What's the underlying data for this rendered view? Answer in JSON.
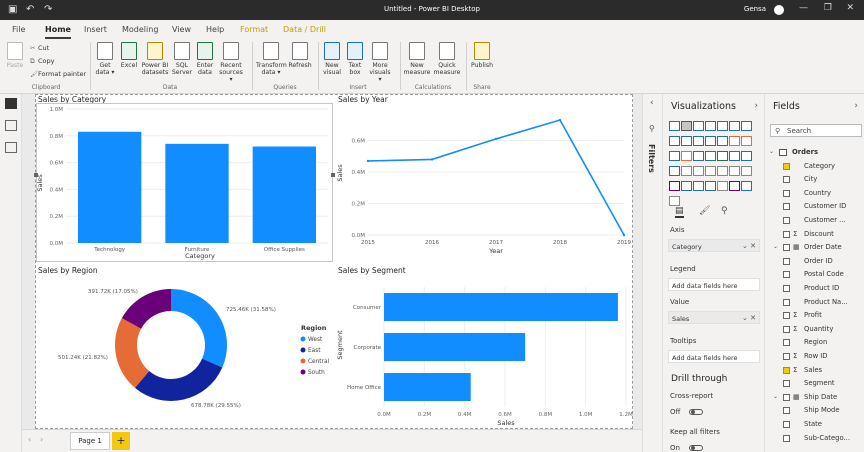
{
  "window": {
    "title": "Untitled - Power BI Desktop",
    "user": "Gensa"
  },
  "menu": {
    "file": "File",
    "home": "Home",
    "insert": "Insert",
    "modeling": "Modeling",
    "view": "View",
    "help": "Help",
    "format": "Format",
    "data_drill": "Data / Drill"
  },
  "ribbon": {
    "paste": "Paste",
    "cut": "Cut",
    "copy": "Copy",
    "format_painter": "Format painter",
    "clipboard_group": "Clipboard",
    "get_data": "Get data",
    "excel": "Excel",
    "pbi_datasets": "Power BI datasets",
    "sql_server": "SQL Server",
    "enter_data": "Enter data",
    "recent_sources": "Recent sources",
    "data_group": "Data",
    "transform_data": "Transform data",
    "refresh": "Refresh",
    "queries_group": "Queries",
    "new_visual": "New visual",
    "text_box": "Text box",
    "more_visuals": "More visuals",
    "insert_group": "Insert",
    "new_measure": "New measure",
    "quick_measure": "Quick measure",
    "calculations_group": "Calculations",
    "publish": "Publish",
    "share_group": "Share"
  },
  "report": {
    "category": {
      "title": "Sales by Category",
      "ylabel": "Sales",
      "xlabel": "Category"
    },
    "year": {
      "title": "Sales by Year",
      "ylabel": "Sales",
      "xlabel": "Year"
    },
    "region": {
      "title": "Sales by Region",
      "legend_title": "Region"
    },
    "segment": {
      "title": "Sales by Segment",
      "ylabel": "Segment",
      "xlabel": "Sales"
    }
  },
  "chart_data": [
    {
      "type": "bar",
      "title": "Sales by Category",
      "xlabel": "Category",
      "ylabel": "Sales",
      "categories": [
        "Technology",
        "Furniture",
        "Office Supplies"
      ],
      "values": [
        0.83,
        0.74,
        0.72
      ],
      "unit": "M",
      "ylim": [
        0,
        1.0
      ],
      "yticks": [
        "0.0M",
        "0.2M",
        "0.4M",
        "0.6M",
        "0.8M",
        "1.0M"
      ]
    },
    {
      "type": "line",
      "title": "Sales by Year",
      "xlabel": "Year",
      "ylabel": "Sales",
      "x": [
        2015,
        2016,
        2017,
        2018,
        2019
      ],
      "values": [
        0.47,
        0.48,
        0.61,
        0.73,
        0.0
      ],
      "unit": "M",
      "ylim": [
        0,
        0.8
      ],
      "yticks": [
        "0.0M",
        "0.2M",
        "0.4M",
        "0.6M"
      ]
    },
    {
      "type": "pie",
      "subtype": "donut",
      "title": "Sales by Region",
      "legend_title": "Region",
      "slices": [
        {
          "name": "West",
          "value": 725.46,
          "label": "725.46K (31.58%)",
          "color": "#118DFF"
        },
        {
          "name": "East",
          "value": 678.78,
          "label": "678.78K (29.55%)",
          "color": "#12239E"
        },
        {
          "name": "Central",
          "value": 501.24,
          "label": "501.24K (21.82%)",
          "color": "#E66C37"
        },
        {
          "name": "South",
          "value": 391.72,
          "label": "391.72K (17.05%)",
          "color": "#6B007B"
        }
      ]
    },
    {
      "type": "bar",
      "orientation": "horizontal",
      "title": "Sales by Segment",
      "xlabel": "Sales",
      "ylabel": "Segment",
      "categories": [
        "Consumer",
        "Corporate",
        "Home Office"
      ],
      "values": [
        1.16,
        0.7,
        0.43
      ],
      "unit": "M",
      "xlim": [
        0,
        1.2
      ],
      "xticks": [
        "0.0M",
        "0.2M",
        "0.4M",
        "0.6M",
        "0.8M",
        "1.0M",
        "1.2M"
      ]
    }
  ],
  "pages": {
    "page1": "Page 1",
    "add": "+"
  },
  "filters": {
    "label": "Filters"
  },
  "visualizations": {
    "title": "Visualizations",
    "axis": "Axis",
    "axis_value": "Category",
    "legend": "Legend",
    "add_fields": "Add data fields here",
    "value": "Value",
    "value_field": "Sales",
    "tooltips": "Tooltips",
    "drill_through": "Drill through",
    "cross_report": "Cross-report",
    "off": "Off",
    "keep_all_filters": "Keep all filters",
    "on": "On"
  },
  "fields": {
    "title": "Fields",
    "search_placeholder": "Search",
    "items": [
      {
        "name": "Orders",
        "kind": "table"
      },
      {
        "name": "Category",
        "kind": "field",
        "checked": true
      },
      {
        "name": "City",
        "kind": "field"
      },
      {
        "name": "Country",
        "kind": "field"
      },
      {
        "name": "Customer ID",
        "kind": "field"
      },
      {
        "name": "Customer ...",
        "kind": "field"
      },
      {
        "name": "Discount",
        "kind": "measure"
      },
      {
        "name": "Order Date",
        "kind": "group"
      },
      {
        "name": "Order ID",
        "kind": "field"
      },
      {
        "name": "Postal Code",
        "kind": "field"
      },
      {
        "name": "Product ID",
        "kind": "field"
      },
      {
        "name": "Product Na...",
        "kind": "field"
      },
      {
        "name": "Profit",
        "kind": "measure"
      },
      {
        "name": "Quantity",
        "kind": "measure"
      },
      {
        "name": "Region",
        "kind": "field"
      },
      {
        "name": "Row ID",
        "kind": "measure"
      },
      {
        "name": "Sales",
        "kind": "measure",
        "checked": true
      },
      {
        "name": "Segment",
        "kind": "field"
      },
      {
        "name": "Ship Date",
        "kind": "group"
      },
      {
        "name": "Ship Mode",
        "kind": "field"
      },
      {
        "name": "State",
        "kind": "field"
      },
      {
        "name": "Sub-Catego...",
        "kind": "field"
      }
    ]
  },
  "colors": {
    "accent": "#118DFF",
    "brand_yellow": "#F2C811"
  }
}
